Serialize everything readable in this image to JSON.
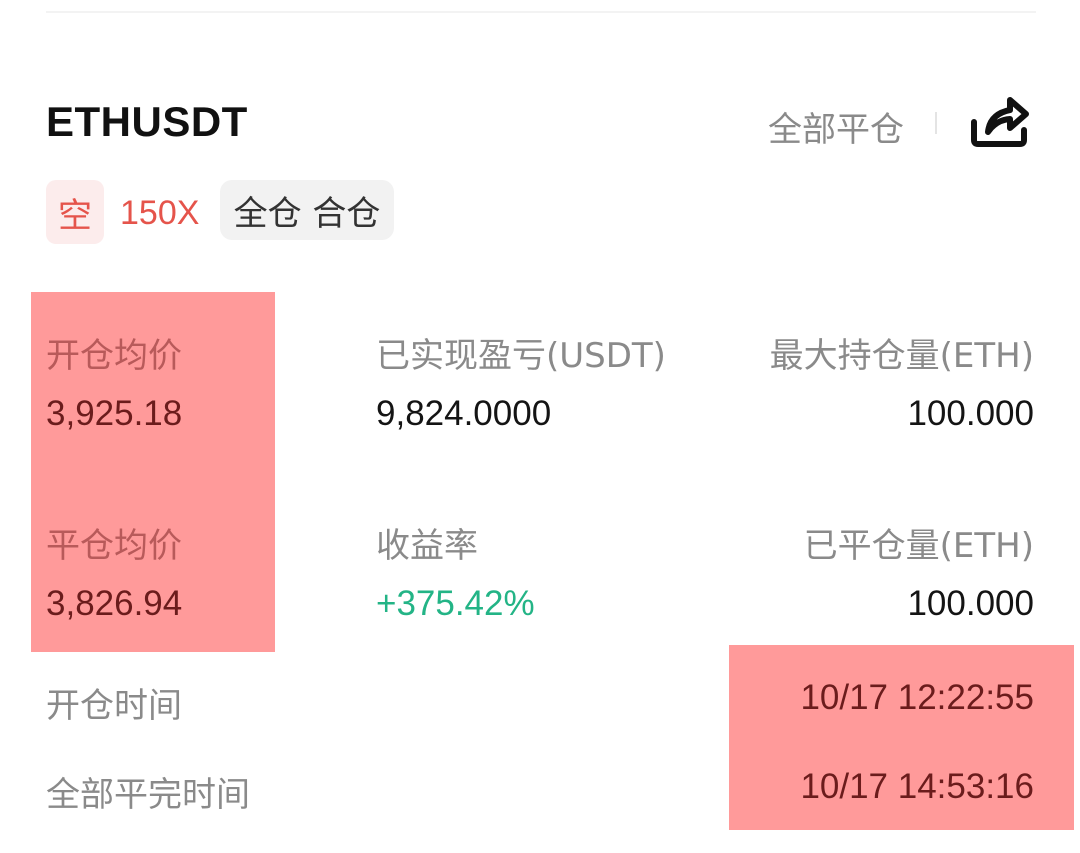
{
  "header": {
    "symbol": "ETHUSDT",
    "close_all_label": "全部平仓",
    "share_icon": "share-icon"
  },
  "tags": {
    "side": "空",
    "leverage": "150X",
    "margin_mode": "全仓 合仓"
  },
  "stats": {
    "open_avg_price": {
      "label": "开仓均价",
      "value": "3,925.18"
    },
    "realized_pnl": {
      "label": "已实现盈亏(USDT)",
      "value": "9,824.0000"
    },
    "max_position": {
      "label": "最大持仓量(ETH)",
      "value": "100.000"
    },
    "close_avg_price": {
      "label": "平仓均价",
      "value": "3,826.94"
    },
    "roi": {
      "label": "收益率",
      "value": "+375.42%"
    },
    "closed_amount": {
      "label": "已平仓量(ETH)",
      "value": "100.000"
    }
  },
  "times": {
    "open_time": {
      "label": "开仓时间",
      "value": "10/17 12:22:55"
    },
    "close_all_time": {
      "label": "全部平完时间",
      "value": "10/17 14:53:16"
    }
  },
  "colors": {
    "short": "#e5544b",
    "profit": "#23b486",
    "highlight": "#ff9a9a"
  }
}
